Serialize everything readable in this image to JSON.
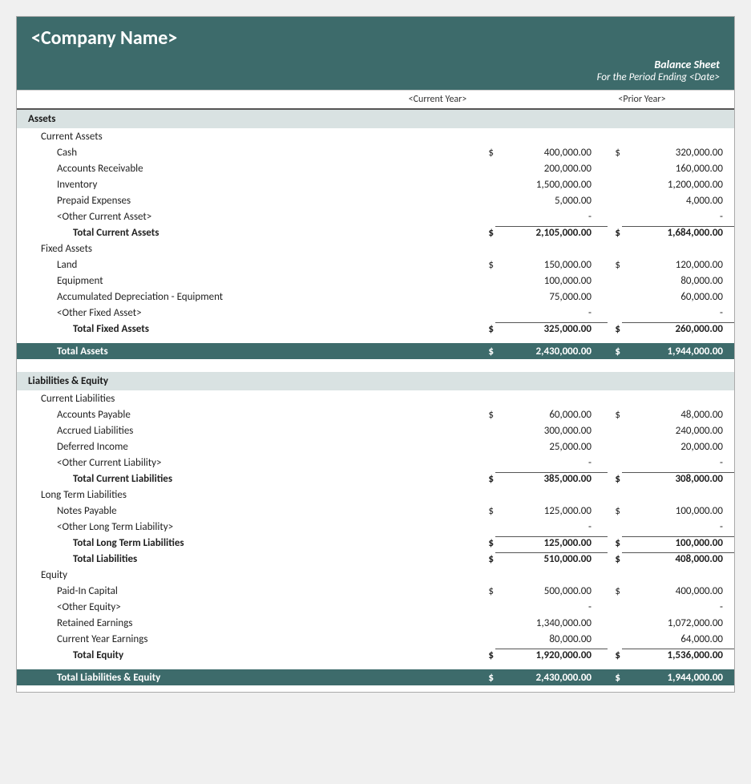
{
  "header": {
    "company_name": "<Company Name>",
    "report_title": "Balance Sheet",
    "report_subtitle": "For the Period Ending <Date>",
    "col_cy": "<Current Year>",
    "col_py": "<Prior Year>"
  },
  "sections": [
    {
      "id": "assets",
      "label": "Assets",
      "subsections": [
        {
          "id": "current_assets",
          "label": "Current Assets",
          "rows": [
            {
              "label": "Cash",
              "dollar_cy": "$",
              "cy": "400,000.00",
              "dollar_py": "$",
              "py": "320,000.00"
            },
            {
              "label": "Accounts Receivable",
              "dollar_cy": "",
              "cy": "200,000.00",
              "dollar_py": "",
              "py": "160,000.00"
            },
            {
              "label": "Inventory",
              "dollar_cy": "",
              "cy": "1,500,000.00",
              "dollar_py": "",
              "py": "1,200,000.00"
            },
            {
              "label": "Prepaid Expenses",
              "dollar_cy": "",
              "cy": "5,000.00",
              "dollar_py": "",
              "py": "4,000.00"
            },
            {
              "label": "<Other Current Asset>",
              "dollar_cy": "",
              "cy": "-",
              "dollar_py": "",
              "py": "-"
            }
          ],
          "total": {
            "label": "Total Current Assets",
            "dollar_cy": "$",
            "cy": "2,105,000.00",
            "dollar_py": "$",
            "py": "1,684,000.00"
          }
        },
        {
          "id": "fixed_assets",
          "label": "Fixed Assets",
          "rows": [
            {
              "label": "Land",
              "dollar_cy": "$",
              "cy": "150,000.00",
              "dollar_py": "$",
              "py": "120,000.00"
            },
            {
              "label": "Equipment",
              "dollar_cy": "",
              "cy": "100,000.00",
              "dollar_py": "",
              "py": "80,000.00"
            },
            {
              "label": "Accumulated Depreciation - Equipment",
              "dollar_cy": "",
              "cy": "75,000.00",
              "dollar_py": "",
              "py": "60,000.00"
            },
            {
              "label": "<Other Fixed Asset>",
              "dollar_cy": "",
              "cy": "-",
              "dollar_py": "",
              "py": "-"
            }
          ],
          "total": {
            "label": "Total Fixed Assets",
            "dollar_cy": "$",
            "cy": "325,000.00",
            "dollar_py": "$",
            "py": "260,000.00"
          }
        }
      ],
      "grand_total": {
        "label": "Total Assets",
        "dollar_cy": "$",
        "cy": "2,430,000.00",
        "dollar_py": "$",
        "py": "1,944,000.00"
      }
    },
    {
      "id": "liabilities_equity",
      "label": "Liabilities & Equity",
      "subsections": [
        {
          "id": "current_liabilities",
          "label": "Current Liabilities",
          "rows": [
            {
              "label": "Accounts Payable",
              "dollar_cy": "$",
              "cy": "60,000.00",
              "dollar_py": "$",
              "py": "48,000.00"
            },
            {
              "label": "Accrued Liabilities",
              "dollar_cy": "",
              "cy": "300,000.00",
              "dollar_py": "",
              "py": "240,000.00"
            },
            {
              "label": "Deferred Income",
              "dollar_cy": "",
              "cy": "25,000.00",
              "dollar_py": "",
              "py": "20,000.00"
            },
            {
              "label": "<Other Current Liability>",
              "dollar_cy": "",
              "cy": "-",
              "dollar_py": "",
              "py": "-"
            }
          ],
          "total": {
            "label": "Total Current Liabilities",
            "dollar_cy": "$",
            "cy": "385,000.00",
            "dollar_py": "$",
            "py": "308,000.00"
          }
        },
        {
          "id": "long_term_liabilities",
          "label": "Long Term Liabilities",
          "rows": [
            {
              "label": "Notes Payable",
              "dollar_cy": "$",
              "cy": "125,000.00",
              "dollar_py": "$",
              "py": "100,000.00"
            },
            {
              "label": "<Other Long Term Liability>",
              "dollar_cy": "",
              "cy": "-",
              "dollar_py": "",
              "py": "-"
            }
          ],
          "total": {
            "label": "Total Long Term Liabilities",
            "dollar_cy": "$",
            "cy": "125,000.00",
            "dollar_py": "$",
            "py": "100,000.00"
          }
        },
        {
          "id": "total_liabilities",
          "label": null,
          "rows": [],
          "total": {
            "label": "Total Liabilities",
            "dollar_cy": "$",
            "cy": "510,000.00",
            "dollar_py": "$",
            "py": "408,000.00"
          }
        },
        {
          "id": "equity",
          "label": "Equity",
          "rows": [
            {
              "label": "Paid-In Capital",
              "dollar_cy": "$",
              "cy": "500,000.00",
              "dollar_py": "$",
              "py": "400,000.00"
            },
            {
              "label": "<Other Equity>",
              "dollar_cy": "",
              "cy": "-",
              "dollar_py": "",
              "py": "-"
            },
            {
              "label": "Retained Earnings",
              "dollar_cy": "",
              "cy": "1,340,000.00",
              "dollar_py": "",
              "py": "1,072,000.00"
            },
            {
              "label": "Current Year Earnings",
              "dollar_cy": "",
              "cy": "80,000.00",
              "dollar_py": "",
              "py": "64,000.00"
            }
          ],
          "total": {
            "label": "Total Equity",
            "dollar_cy": "$",
            "cy": "1,920,000.00",
            "dollar_py": "$",
            "py": "1,536,000.00"
          }
        }
      ],
      "grand_total": {
        "label": "Total Liabilities & Equity",
        "dollar_cy": "$",
        "cy": "2,430,000.00",
        "dollar_py": "$",
        "py": "1,944,000.00"
      }
    }
  ]
}
